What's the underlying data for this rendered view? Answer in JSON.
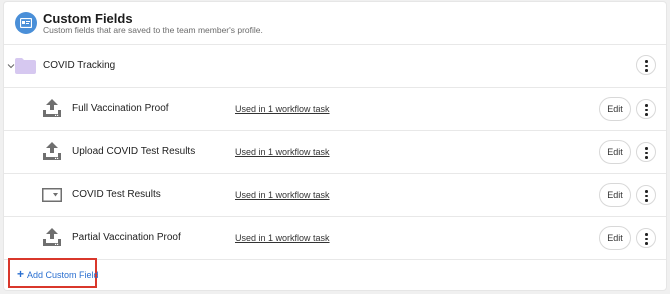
{
  "header": {
    "title": "Custom Fields",
    "subtitle": "Custom fields that are saved to the team member's profile.",
    "icon": "id-card-icon",
    "icon_color": "#4a8fd8"
  },
  "group": {
    "label": "COVID Tracking",
    "expanded": true,
    "folder_color": "#d6c8f0"
  },
  "fields": [
    {
      "name": "Full Vaccination Proof",
      "usage": "Used in 1 workflow task",
      "edit_label": "Edit",
      "icon": "upload-icon"
    },
    {
      "name": "Upload COVID Test Results",
      "usage": "Used in 1 workflow task",
      "edit_label": "Edit",
      "icon": "upload-icon"
    },
    {
      "name": "COVID Test Results",
      "usage": "Used in 1 workflow task",
      "edit_label": "Edit",
      "icon": "dropdown-icon"
    },
    {
      "name": "Partial Vaccination Proof",
      "usage": "Used in 1 workflow task",
      "edit_label": "Edit",
      "icon": "upload-icon"
    }
  ],
  "add_field": {
    "label": "Add Custom Field",
    "accent": "#2a6fd0",
    "highlight_color": "#d9372b"
  }
}
